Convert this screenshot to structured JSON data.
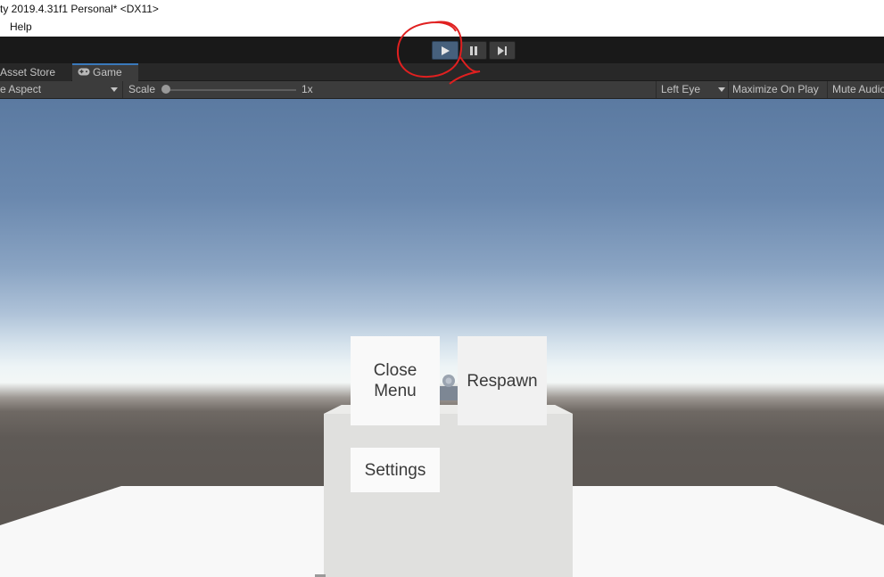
{
  "window": {
    "title": "ty 2019.4.31f1 Personal* <DX11>"
  },
  "menubar": {
    "items": [
      "Help"
    ]
  },
  "toolbar": {
    "play": {
      "icon": "play-icon",
      "state": "active"
    },
    "pause": {
      "icon": "pause-icon"
    },
    "step": {
      "icon": "step-icon"
    },
    "annotation_color": "#e02020"
  },
  "tabs": [
    {
      "label": "Asset Store",
      "selected": false
    },
    {
      "label": "Game",
      "icon": "gamepad-icon",
      "selected": true
    }
  ],
  "game_toolbar": {
    "aspect": "e Aspect",
    "scale_label": "Scale",
    "scale_value": "1x",
    "eye": "Left Eye",
    "maximize": "Maximize On Play",
    "mute": "Mute Audio"
  },
  "scene": {
    "buttons": {
      "close_menu": "Close\nMenu",
      "respawn": "Respawn",
      "settings": "Settings"
    },
    "colors": {
      "sky_top": "#5b7aa1",
      "horizon": "#edf4f6",
      "ground": "#5f5a56",
      "floor": "#f8f8f8",
      "active_play": "#46607c"
    }
  }
}
